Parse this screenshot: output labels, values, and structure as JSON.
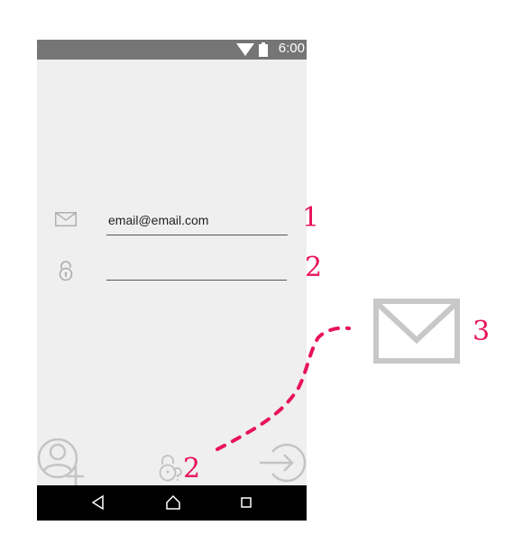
{
  "status_bar": {
    "time": "6:00",
    "icons": [
      "wifi-icon",
      "battery-icon"
    ],
    "background": "#757575"
  },
  "form": {
    "email": {
      "icon": "mail-icon",
      "value": "email@email.com"
    },
    "password": {
      "icon": "lock-icon",
      "value": ""
    }
  },
  "bottom_actions": {
    "left": "add-user-icon",
    "center": "forgot-password-icon",
    "right": "sign-in-icon"
  },
  "nav_bar": {
    "buttons": [
      "back-icon",
      "home-icon",
      "recents-icon"
    ],
    "background": "#000000"
  },
  "annotations": {
    "label_1": "1",
    "label_2": "2",
    "label_2_bottom": "2",
    "label_3": "3",
    "accent": "#e8135a"
  },
  "callout": {
    "icon": "mail-icon-large"
  },
  "colors": {
    "screen_background": "#efefef",
    "icon_gray": "#b8b8b8"
  }
}
